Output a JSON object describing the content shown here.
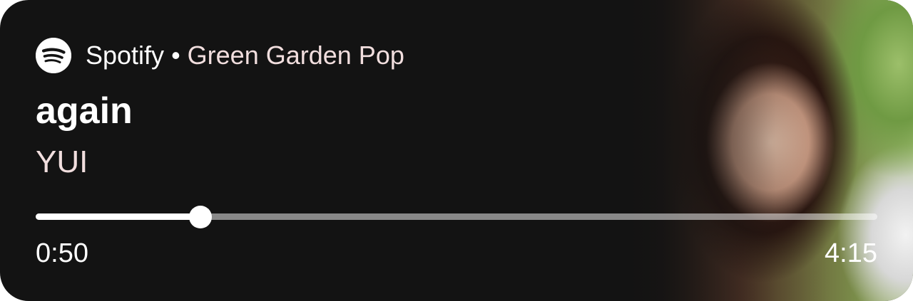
{
  "header": {
    "app_name": "Spotify",
    "separator": "•",
    "playlist": "Green Garden Pop"
  },
  "track": {
    "title": "again",
    "artist": "YUI"
  },
  "progress": {
    "elapsed": "0:50",
    "total": "4:15",
    "fraction": 0.196
  },
  "icons": {
    "app_icon": "spotify-icon"
  },
  "colors": {
    "background": "#131313",
    "text_primary": "#ffffff",
    "text_accent": "#f1dede"
  }
}
